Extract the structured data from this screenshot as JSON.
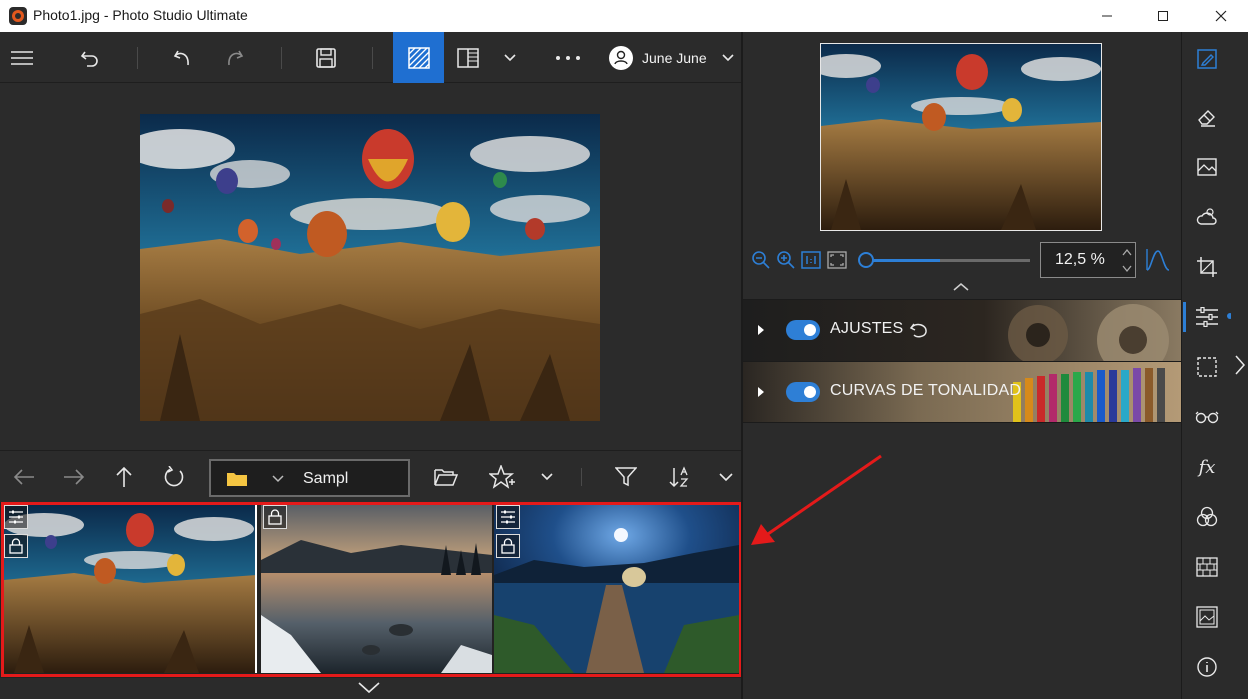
{
  "window": {
    "title": "Photo1.jpg - Photo Studio Ultimate"
  },
  "toolbar": {
    "user_name": "June June",
    "icons": [
      "menu-icon",
      "undo-history-icon",
      "undo-icon",
      "redo-icon",
      "save-icon",
      "compare-view-icon",
      "split-view-icon",
      "chevron-down-icon",
      "more-icon",
      "user-icon"
    ]
  },
  "browser": {
    "path_value": "Sampl",
    "icons": [
      "back-icon",
      "forward-icon",
      "up-icon",
      "refresh-icon",
      "folder-icon",
      "open-folder-icon",
      "star-icon",
      "filter-icon",
      "sort-icon"
    ]
  },
  "thumbnails": [
    {
      "name": "balloons",
      "selected": true,
      "badges": [
        "adjust-icon",
        "lock-icon"
      ]
    },
    {
      "name": "lake-sunset",
      "selected": false,
      "badges": [
        "lock-icon"
      ]
    },
    {
      "name": "moon-pier",
      "selected": false,
      "badges": [
        "adjust-icon",
        "lock-icon"
      ]
    }
  ],
  "zoom": {
    "value": "12,5 %",
    "slider_level": 0.45
  },
  "panels": [
    {
      "label": "AJUSTES",
      "enabled": true
    },
    {
      "label": "CURVAS DE TONALIDAD",
      "enabled": true
    }
  ],
  "colors": {
    "accent": "#1f6fd1",
    "highlight": "#e41a1a",
    "panel_bg": "#2b2b2b"
  }
}
